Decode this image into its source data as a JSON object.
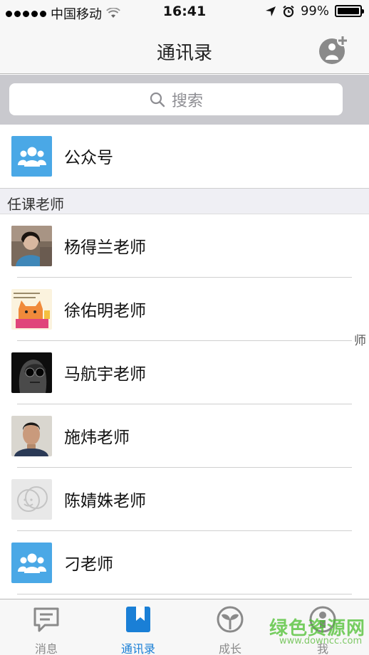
{
  "status_bar": {
    "carrier": "中国移动",
    "time": "16:41",
    "battery": "99%",
    "battery_level": 0.99
  },
  "nav": {
    "title": "通讯录",
    "add_icon": "add-contact-icon"
  },
  "search": {
    "placeholder": "搜索",
    "icon": "search-icon"
  },
  "public_account": {
    "label": "公众号",
    "icon": "group-icon"
  },
  "section": {
    "title": "任课老师"
  },
  "teachers": [
    {
      "name": "杨得兰老师",
      "avatar": "photo-woman"
    },
    {
      "name": "徐佑明老师",
      "avatar": "cartoon-cat"
    },
    {
      "name": "马航宇老师",
      "avatar": "photo-sunglasses"
    },
    {
      "name": "施炜老师",
      "avatar": "photo-man"
    },
    {
      "name": "陈婧姝老师",
      "avatar": "default-face"
    },
    {
      "name": "刁老师",
      "avatar": "group-icon"
    }
  ],
  "stray_text": "师",
  "tabs": [
    {
      "label": "消息",
      "icon": "chat-bubble-icon",
      "active": false
    },
    {
      "label": "通讯录",
      "icon": "contacts-book-icon",
      "active": true
    },
    {
      "label": "成长",
      "icon": "sprout-icon",
      "active": false
    },
    {
      "label": "我",
      "icon": "person-icon",
      "active": false
    }
  ],
  "watermark": {
    "text": "绿色资源网",
    "url": "www.downcc.com"
  },
  "colors": {
    "accent": "#1a7fd6",
    "tile_blue": "#4aa8e6",
    "bar_bg": "#f7f7f7",
    "search_bg": "#c9c9ce"
  }
}
